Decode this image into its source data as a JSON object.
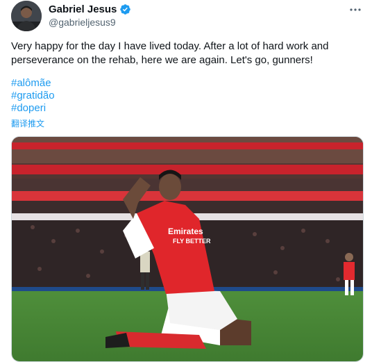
{
  "author": {
    "name": "Gabriel Jesus",
    "handle": "@gabrieljesus9",
    "verified": true,
    "verified_color": "#1d9bf0"
  },
  "tweet": {
    "text": "Very happy for the day I have lived today. After a lot of hard work and perseverance on the rehab, here we are again. Let's go, gunners!",
    "hashtags": [
      "#alômãe",
      "#gratidão",
      "#doperi"
    ],
    "translate_label": "翻译推文"
  },
  "icons": {
    "more": "more-horizontal-icon",
    "verified": "verified-badge-icon"
  },
  "media": {
    "description_icon": "photo",
    "jersey_sponsor": "Emirates FLY BETTER"
  },
  "colors": {
    "link": "#1d9bf0",
    "text": "#0f1419",
    "secondary": "#536471"
  }
}
